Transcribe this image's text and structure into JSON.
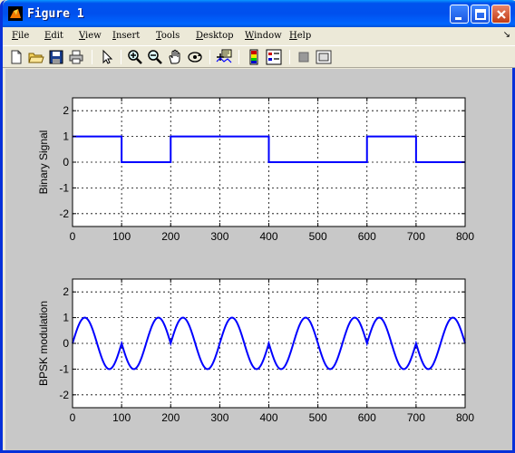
{
  "window": {
    "title": "Figure 1"
  },
  "menu": [
    "File",
    "Edit",
    "View",
    "Insert",
    "Tools",
    "Desktop",
    "Window",
    "Help"
  ],
  "menu_mnemonic": [
    "F",
    "E",
    "V",
    "I",
    "T",
    "D",
    "W",
    "H"
  ],
  "toolbar": [
    "new-figure",
    "open-file",
    "save",
    "print",
    "edit-plot-arrow",
    "zoom-in",
    "zoom-out",
    "pan",
    "rotate-3d",
    "data-cursor",
    "colorbar",
    "legend",
    "hide-plot-tools",
    "show-plot-tools"
  ],
  "chart_data": [
    {
      "type": "line",
      "ylabel": "Binary Signal",
      "xlim": [
        0,
        800
      ],
      "ylim": [
        -2.5,
        2.5
      ],
      "xticks": [
        0,
        100,
        200,
        300,
        400,
        500,
        600,
        700,
        800
      ],
      "yticks": [
        -2,
        -1,
        0,
        1,
        2
      ],
      "grid": true,
      "color": "#0000ff",
      "bits": [
        1,
        0,
        1,
        1,
        0,
        0,
        1,
        0
      ],
      "series": [
        {
          "x": [
            0,
            100,
            100,
            200,
            200,
            400,
            400,
            600,
            600,
            700,
            700,
            800
          ],
          "y": [
            1,
            1,
            0,
            0,
            1,
            1,
            0,
            0,
            1,
            1,
            0,
            0
          ]
        }
      ]
    },
    {
      "type": "line",
      "ylabel": "BPSK modulation",
      "xlim": [
        0,
        800
      ],
      "ylim": [
        -2.5,
        2.5
      ],
      "xticks": [
        0,
        100,
        200,
        300,
        400,
        500,
        600,
        700,
        800
      ],
      "yticks": [
        -2,
        -1,
        0,
        1,
        2
      ],
      "grid": true,
      "color": "#0000ff",
      "carrier_period": 100,
      "series": [
        {
          "description_of_shape": "y = s(x) * sin(2*pi*x/100), s = +1 for bit 1 and -1 for bit 0",
          "x": [
            0,
            25,
            50,
            75,
            100,
            125,
            150,
            175,
            200,
            225,
            250,
            275,
            300,
            325,
            350,
            375,
            400,
            425,
            450,
            475,
            500,
            525,
            550,
            575,
            600,
            625,
            650,
            675,
            700,
            725,
            750,
            775,
            800
          ],
          "y": [
            0,
            1,
            0,
            -1,
            0,
            -1,
            0,
            1,
            0,
            1,
            0,
            -1,
            0,
            1,
            0,
            -1,
            0,
            -1,
            0,
            1,
            0,
            -1,
            0,
            1,
            0,
            1,
            0,
            -1,
            0,
            -1,
            0,
            1,
            0
          ]
        }
      ]
    }
  ]
}
